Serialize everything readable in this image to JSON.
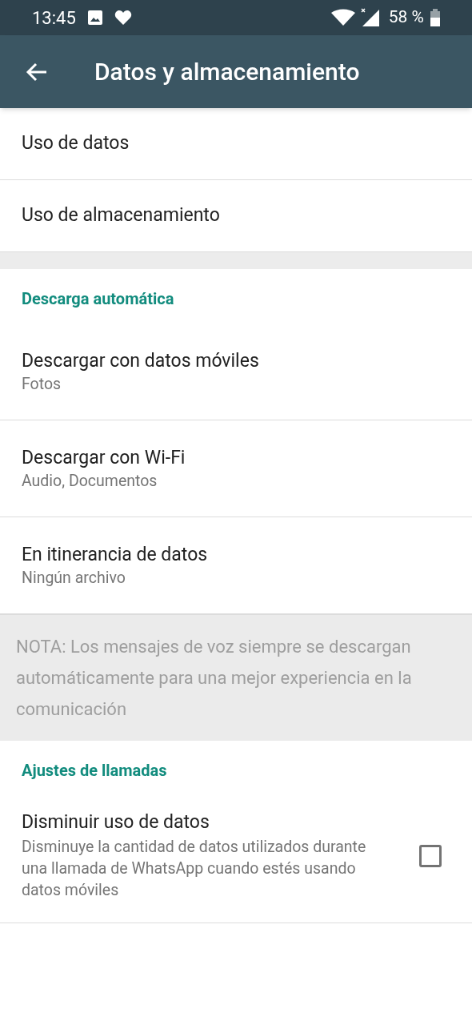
{
  "status_bar": {
    "time": "13:45",
    "battery": "58 %"
  },
  "app_bar": {
    "title": "Datos y almacenamiento"
  },
  "top_items": [
    {
      "title": "Uso de datos"
    },
    {
      "title": "Uso de almacenamiento"
    }
  ],
  "sections": [
    {
      "header": "Descarga automática",
      "items": [
        {
          "title": "Descargar con datos móviles",
          "subtitle": "Fotos"
        },
        {
          "title": "Descargar con Wi-Fi",
          "subtitle": "Audio, Documentos"
        },
        {
          "title": "En itinerancia de datos",
          "subtitle": "Ningún archivo"
        }
      ],
      "note": "NOTA: Los mensajes de voz siempre se descargan automáticamente para una mejor experiencia en la comunicación"
    },
    {
      "header": "Ajustes de llamadas",
      "items": [
        {
          "title": "Disminuir uso de datos",
          "subtitle": "Disminuye la cantidad de datos utilizados durante una llamada de WhatsApp cuando estés usando datos móviles",
          "checked": false
        }
      ]
    }
  ]
}
